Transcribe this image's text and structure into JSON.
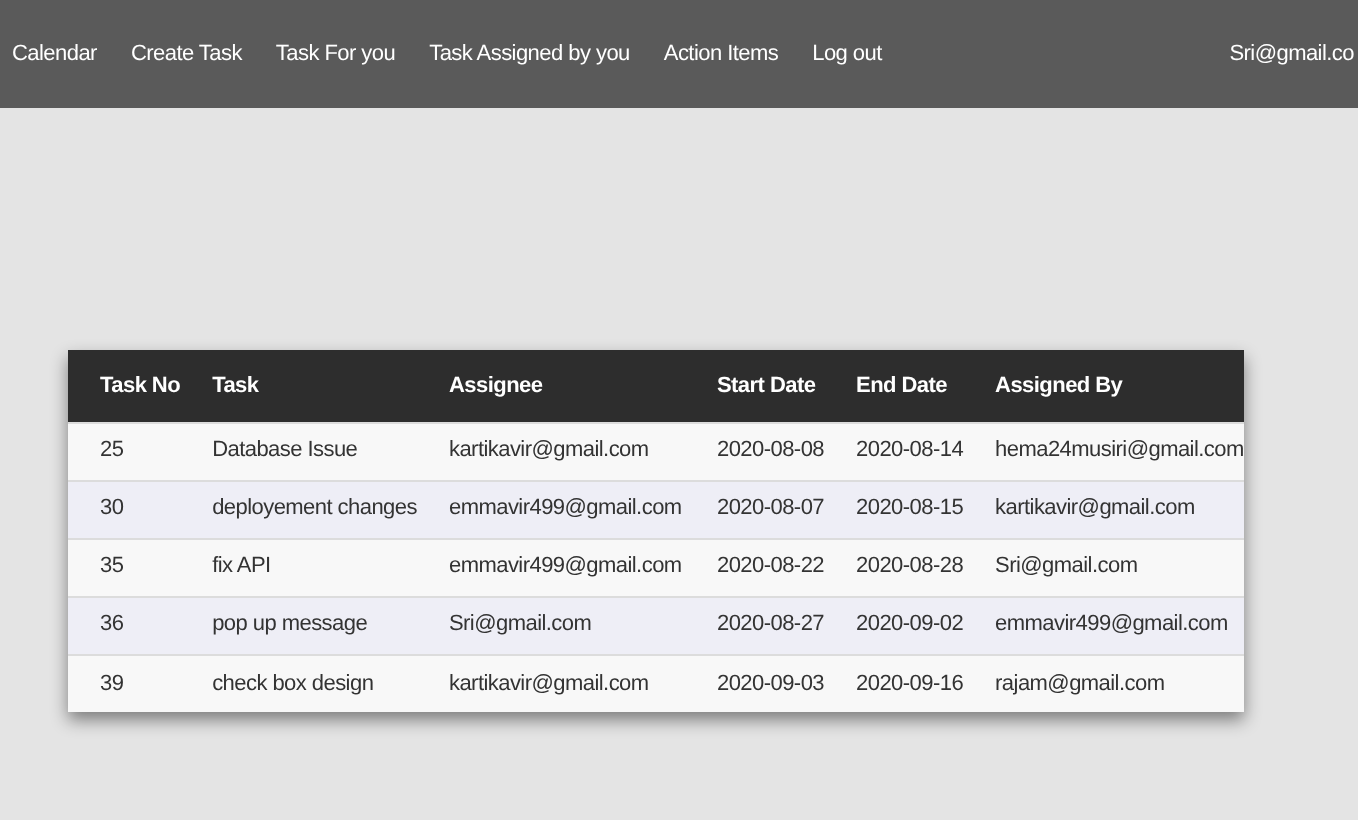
{
  "navbar": {
    "links": [
      "Calendar",
      "Create Task",
      "Task For you",
      "Task Assigned by you",
      "Action Items",
      "Log out"
    ],
    "user": "Sri@gmail.co"
  },
  "table": {
    "columns": [
      "Task No",
      "Task",
      "Assignee",
      "Start Date",
      "End Date",
      "Assigned By"
    ],
    "rows": [
      [
        "25",
        "Database Issue",
        "kartikavir@gmail.com",
        "2020-08-08",
        "2020-08-14",
        "hema24musiri@gmail.com"
      ],
      [
        "30",
        "deployement changes",
        "emmavir499@gmail.com",
        "2020-08-07",
        "2020-08-15",
        "kartikavir@gmail.com"
      ],
      [
        "35",
        "fix API",
        "emmavir499@gmail.com",
        "2020-08-22",
        "2020-08-28",
        "Sri@gmail.com"
      ],
      [
        "36",
        "pop up message",
        "Sri@gmail.com",
        "2020-08-27",
        "2020-09-02",
        "emmavir499@gmail.com"
      ],
      [
        "39",
        "check box design",
        "kartikavir@gmail.com",
        "2020-09-03",
        "2020-09-16",
        "rajam@gmail.com"
      ]
    ]
  }
}
